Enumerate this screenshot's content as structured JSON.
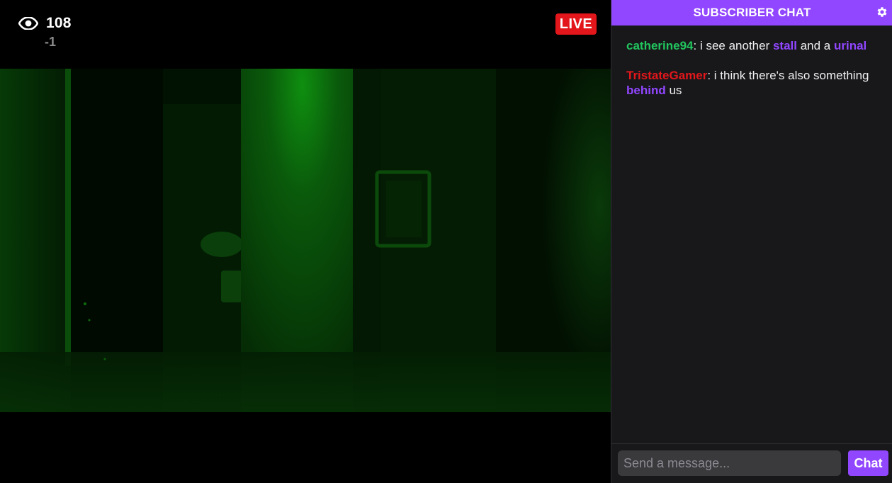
{
  "stream": {
    "viewer_count": "108",
    "viewer_delta": "-1",
    "live_label": "LIVE",
    "viewer_icon": "eye-icon"
  },
  "chat": {
    "header_title": "SUBSCRIBER CHAT",
    "settings_icon": "gear-icon",
    "messages": [
      {
        "username": "catherine94",
        "username_color": "#22c55e",
        "segments": [
          {
            "text": ": i see another ",
            "highlight": false
          },
          {
            "text": "stall",
            "highlight": true
          },
          {
            "text": " and a ",
            "highlight": false
          },
          {
            "text": "urinal",
            "highlight": true
          }
        ]
      },
      {
        "username": "TristateGamer",
        "username_color": "#e3171b",
        "segments": [
          {
            "text": ": i think there's also something ",
            "highlight": false
          },
          {
            "text": "behind",
            "highlight": true
          },
          {
            "text": " us",
            "highlight": false
          }
        ]
      }
    ],
    "input_placeholder": "Send a message...",
    "send_label": "Chat"
  },
  "colors": {
    "brand_purple": "#9146ff",
    "live_red": "#e3171b",
    "chat_bg": "#18181b"
  }
}
